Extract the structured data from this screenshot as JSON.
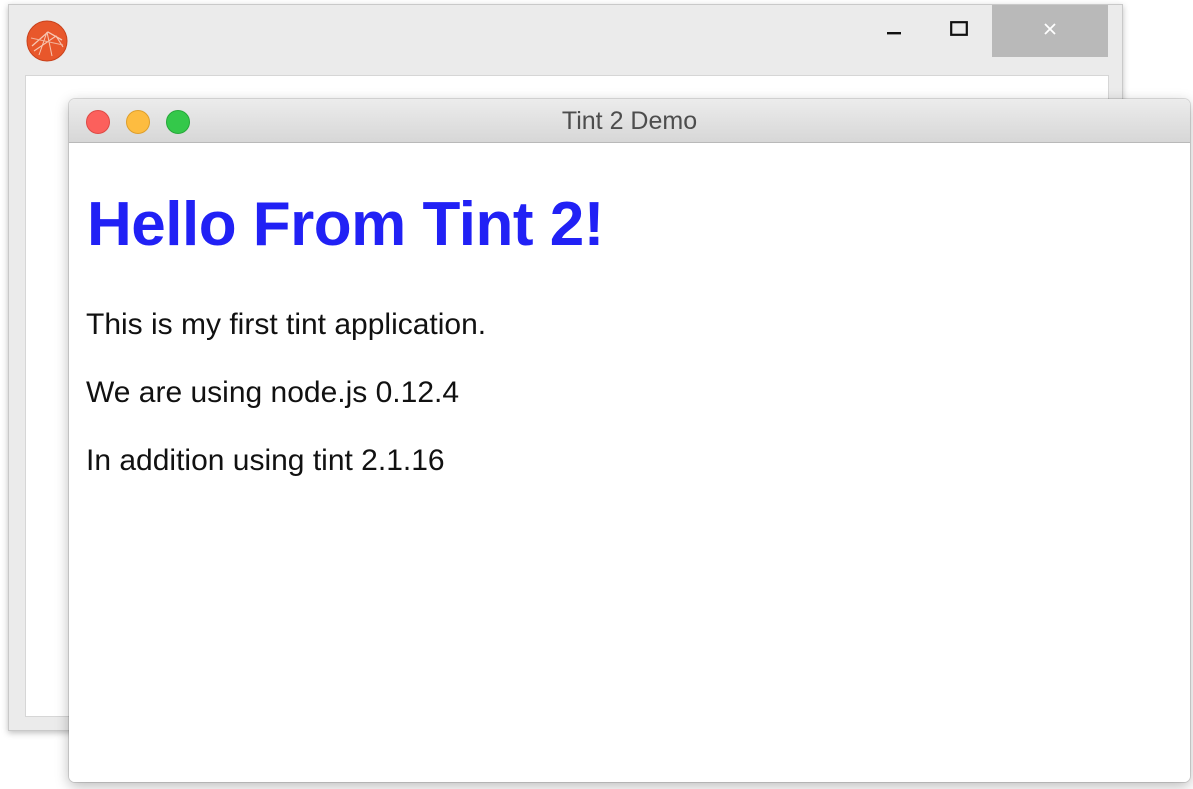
{
  "back_window": {
    "app_icon": "tint-logo-icon",
    "controls": {
      "minimize_icon": "minimize-icon",
      "maximize_icon": "maximize-icon",
      "close_icon": "close-icon",
      "close_glyph": "✕"
    }
  },
  "front_window": {
    "title": "Tint 2 Demo",
    "traffic_lights": {
      "close_color": "#fc605c",
      "minimize_color": "#fdbc40",
      "zoom_color": "#34c84a"
    },
    "content": {
      "heading": "Hello From Tint 2!",
      "heading_color": "#2121f5",
      "paragraphs": [
        "This is my first tint application.",
        "We are using node.js 0.12.4",
        "In addition using tint 2.1.16"
      ]
    }
  }
}
